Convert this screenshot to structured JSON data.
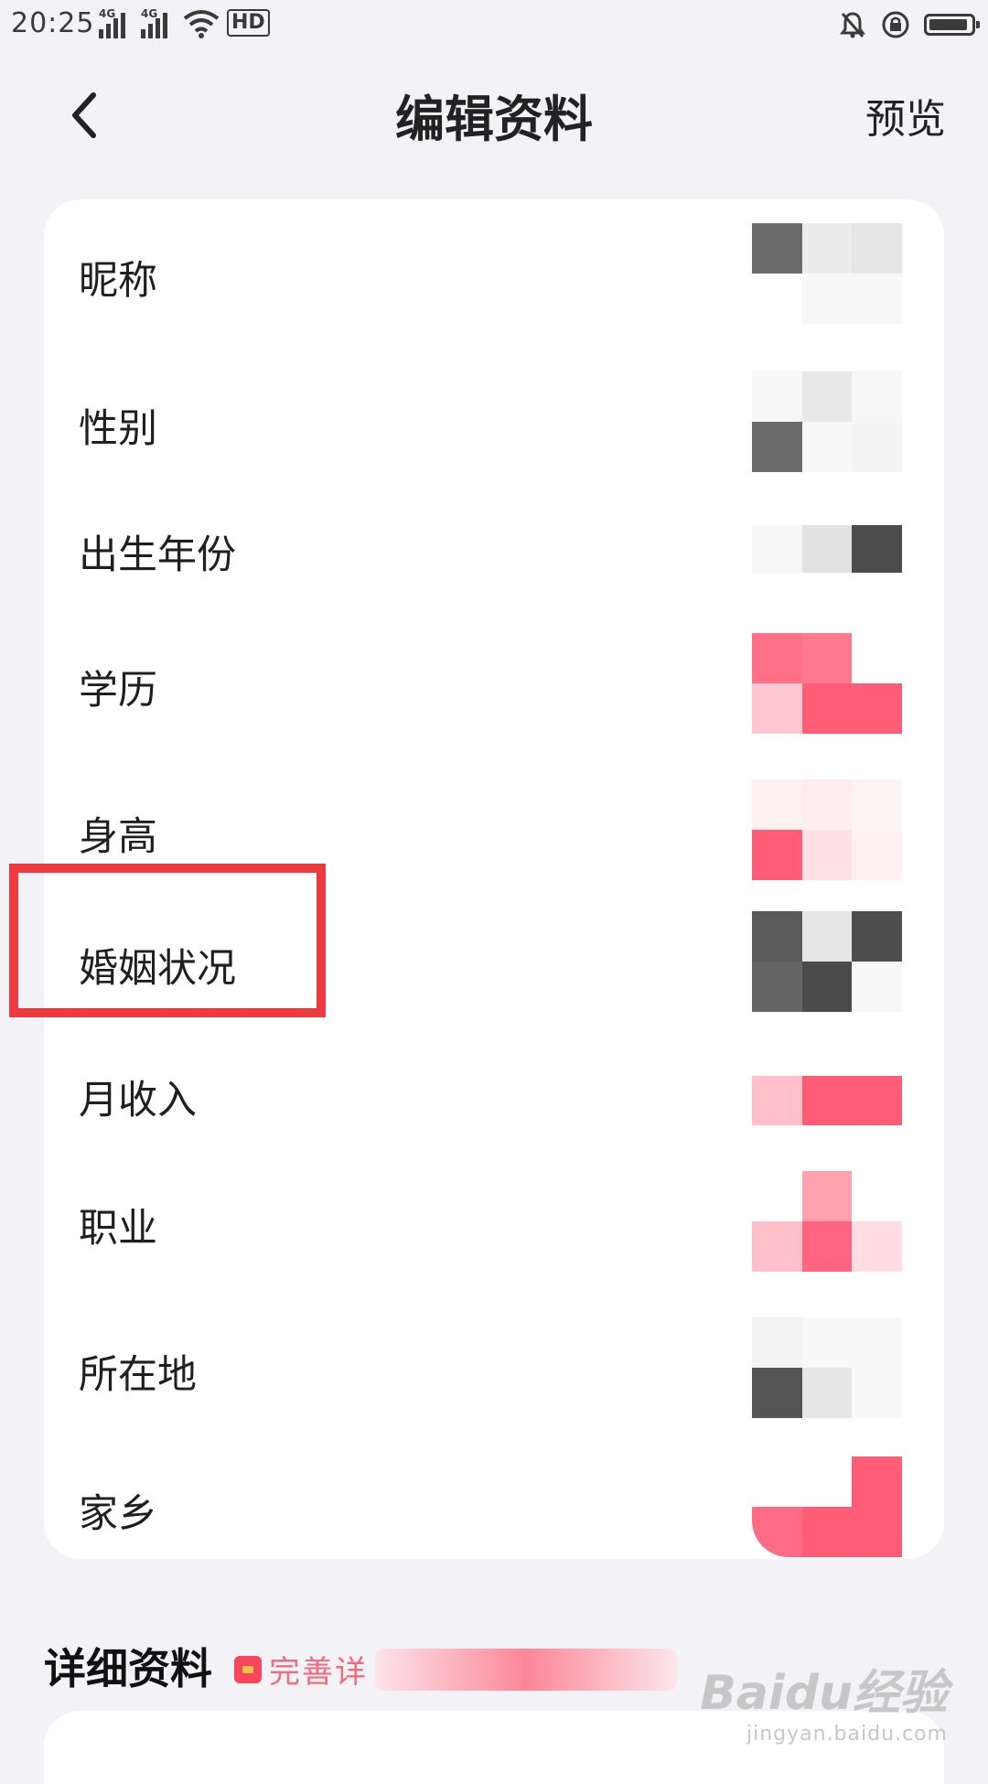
{
  "status_bar": {
    "time": "20:25",
    "signal_tag_1": "4G",
    "signal_tag_2": "4G",
    "hd_label": "HD"
  },
  "nav": {
    "title": "编辑资料",
    "preview_label": "预览"
  },
  "profile_rows": [
    {
      "label": "昵称"
    },
    {
      "label": "性别"
    },
    {
      "label": "出生年份"
    },
    {
      "label": "学历"
    },
    {
      "label": "身高"
    },
    {
      "label": "婚姻状况"
    },
    {
      "label": "月收入"
    },
    {
      "label": "职业"
    },
    {
      "label": "所在地"
    },
    {
      "label": "家乡"
    }
  ],
  "detail_section": {
    "title": "详细资料",
    "badge_text": "完善详"
  },
  "watermark": {
    "main": "Baidu经验",
    "sub": "jingyan.baidu.com"
  },
  "colors": {
    "accent_red": "#ec3a3f",
    "brand_pink": "#ff5c77",
    "background": "#f2f2f7"
  }
}
